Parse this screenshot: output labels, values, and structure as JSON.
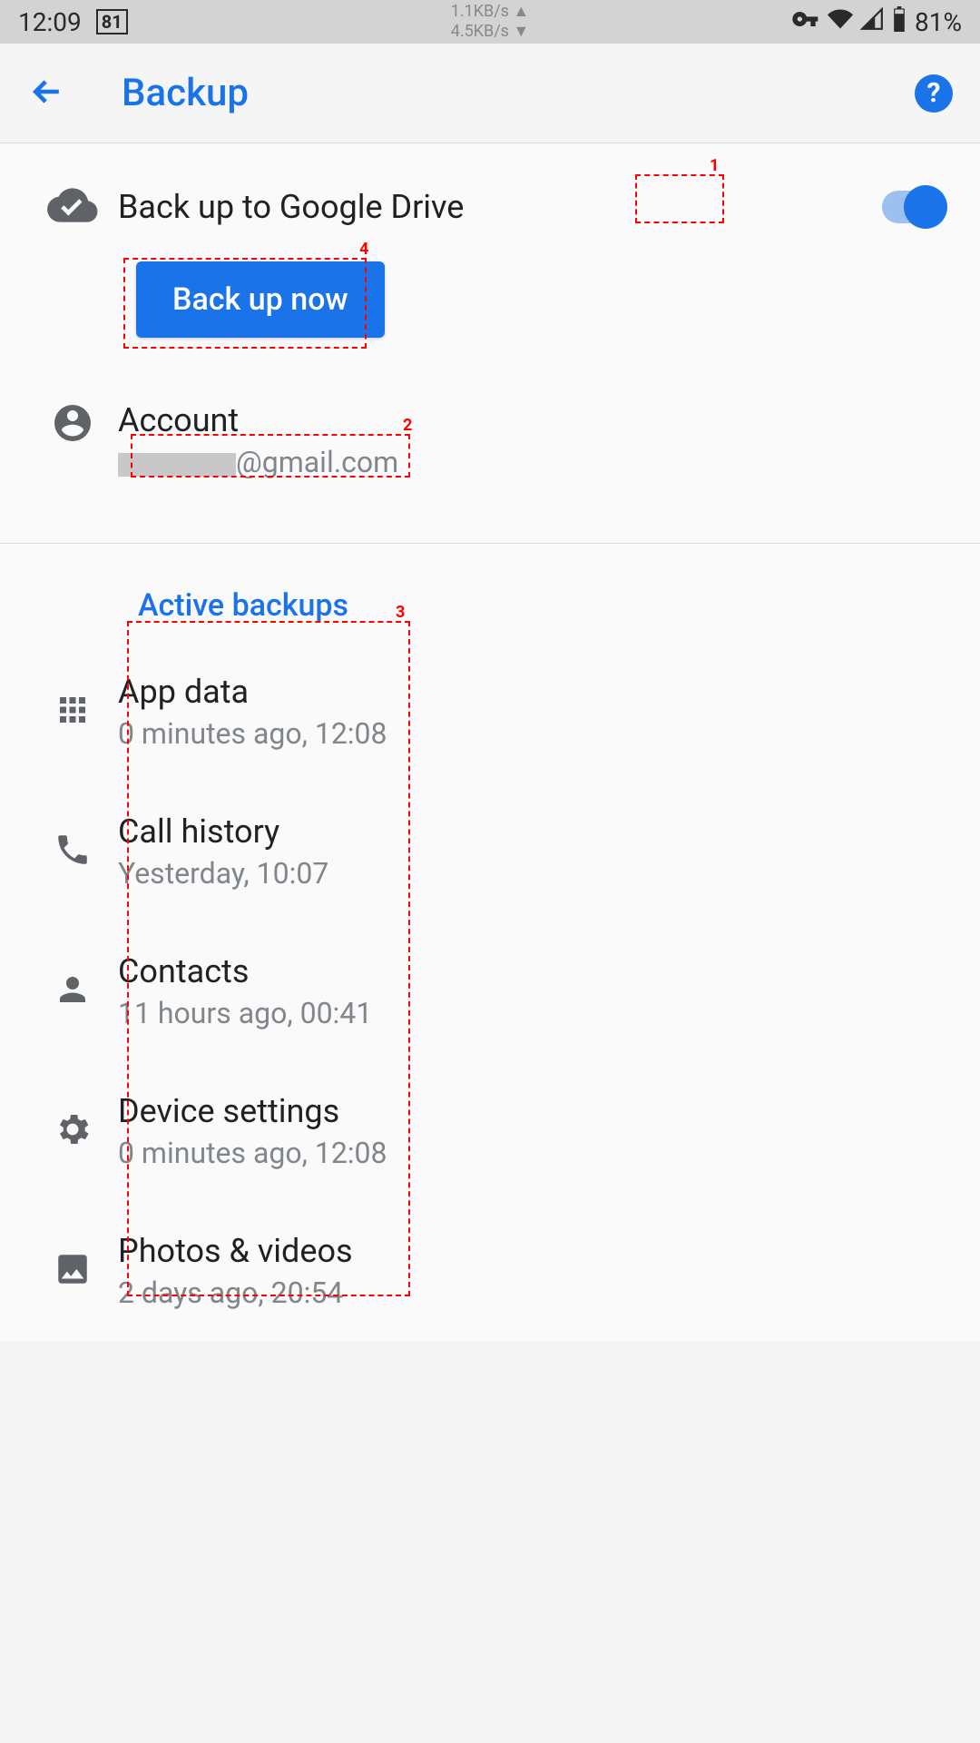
{
  "status": {
    "time": "12:09",
    "calendar": "81",
    "net_up": "1.1KB/s ▲",
    "net_down": "4.5KB/s ▼",
    "battery": "81%"
  },
  "header": {
    "title": "Backup",
    "help": "?"
  },
  "backup": {
    "toggle_label": "Back up to Google Drive",
    "button_label": "Back up now",
    "account_label": "Account",
    "account_email_suffix": "@gmail.com"
  },
  "active_header": "Active backups",
  "items": [
    {
      "title": "App data",
      "subtitle": "0 minutes ago, 12:08",
      "icon": "apps"
    },
    {
      "title": "Call history",
      "subtitle": "Yesterday, 10:07",
      "icon": "phone"
    },
    {
      "title": "Contacts",
      "subtitle": "11 hours ago, 00:41",
      "icon": "person"
    },
    {
      "title": "Device settings",
      "subtitle": "0 minutes ago, 12:08",
      "icon": "gear"
    },
    {
      "title": "Photos & videos",
      "subtitle": "2 days ago, 20:54",
      "icon": "image"
    }
  ],
  "annotations": {
    "1": "1",
    "2": "2",
    "3": "3",
    "4": "4"
  }
}
